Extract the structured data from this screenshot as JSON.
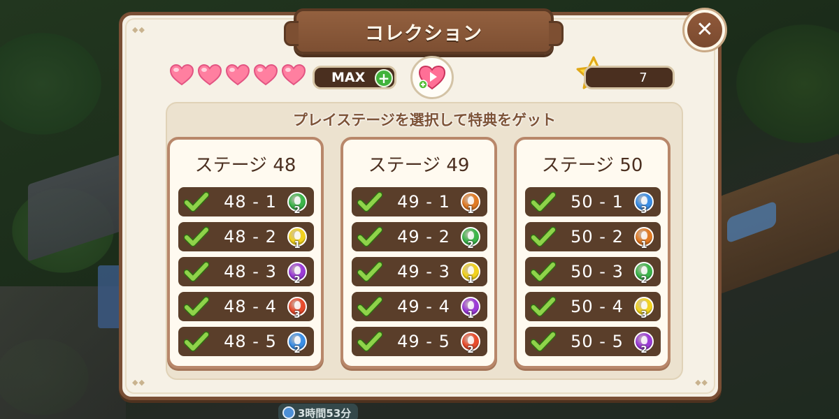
{
  "title": "コレクション",
  "hearts": {
    "filled": 5,
    "max_label": "MAX"
  },
  "stars": {
    "count": "7"
  },
  "panel": {
    "header": "プレイステージを選択して特典をゲット"
  },
  "colors": {
    "green": "#3cb54a",
    "yellow": "#f2d21e",
    "purple": "#9b3bd6",
    "red": "#e84b2c",
    "blue": "#3a8ee6",
    "orange": "#e07a24"
  },
  "stages": [
    {
      "title": "ステージ 48",
      "rows": [
        {
          "label": "48 - 1",
          "color": "green",
          "count": "2"
        },
        {
          "label": "48 - 2",
          "color": "yellow",
          "count": "1"
        },
        {
          "label": "48 - 3",
          "color": "purple",
          "count": "2"
        },
        {
          "label": "48 - 4",
          "color": "red",
          "count": "3"
        },
        {
          "label": "48 - 5",
          "color": "blue",
          "count": "2"
        }
      ]
    },
    {
      "title": "ステージ 49",
      "rows": [
        {
          "label": "49 - 1",
          "color": "orange",
          "count": "1"
        },
        {
          "label": "49 - 2",
          "color": "green",
          "count": "2"
        },
        {
          "label": "49 - 3",
          "color": "yellow",
          "count": "1"
        },
        {
          "label": "49 - 4",
          "color": "purple",
          "count": "1"
        },
        {
          "label": "49 - 5",
          "color": "red",
          "count": "2"
        }
      ]
    },
    {
      "title": "ステージ 50",
      "rows": [
        {
          "label": "50 - 1",
          "color": "blue",
          "count": "3"
        },
        {
          "label": "50 - 2",
          "color": "orange",
          "count": "1"
        },
        {
          "label": "50 - 3",
          "color": "green",
          "count": "2"
        },
        {
          "label": "50 - 4",
          "color": "yellow",
          "count": "3"
        },
        {
          "label": "50 - 5",
          "color": "purple",
          "count": "2"
        }
      ]
    }
  ],
  "timer": {
    "label": "3時間53分"
  }
}
